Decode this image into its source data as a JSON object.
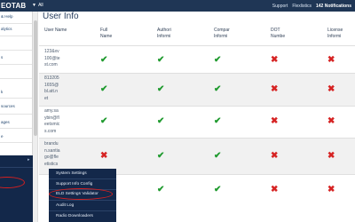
{
  "topbar": {
    "logo": "EOTAB",
    "database_selector": "All",
    "links": [
      "Support",
      "Flexlistics"
    ],
    "notifications": "142 Notifications"
  },
  "sidebar": {
    "items": [
      "& Help",
      "alytics"
    ],
    "partial_labels": [
      "s",
      "k",
      "sources",
      "ages",
      "e"
    ]
  },
  "main": {
    "title": "User Info",
    "columns": [
      "User Name",
      "Full Name",
      "Authori Informi",
      "Compar Informi",
      "DOT Numbe",
      "License Informi"
    ],
    "rows": [
      {
        "user": [
          "123&xv",
          "100@te",
          "st.com"
        ],
        "full_name": true,
        "authority": true,
        "company": true,
        "dot": false,
        "license": false
      },
      {
        "user": [
          "813205",
          "1655@",
          "bl.att.n",
          "et"
        ],
        "full_name": true,
        "authority": true,
        "company": true,
        "dot": false,
        "license": false
      },
      {
        "user": [
          "amy.sa",
          "ybin@fl",
          "eetsmic",
          "s.com"
        ],
        "full_name": true,
        "authority": true,
        "company": true,
        "dot": false,
        "license": false
      },
      {
        "user": [
          "brandu",
          "n.santia",
          "go@fle",
          "etistics"
        ],
        "full_name": false,
        "authority": true,
        "company": true,
        "dot": false,
        "license": false
      },
      {
        "user": [
          ""
        ],
        "full_name": true,
        "authority": true,
        "company": true,
        "dot": false,
        "license": false
      }
    ]
  },
  "flyout": {
    "items": [
      "System Settings",
      "Support Info Config",
      "ELD Settings Validator",
      "Audit Log",
      "Radio Downloaders"
    ],
    "highlighted": "ELD Settings Validator"
  },
  "colors": {
    "topbar": "#1f3655",
    "flyout": "#13284a",
    "check": "#1f9a2e",
    "cross": "#d62323",
    "highlight_oval": "#d42020"
  },
  "icons": {
    "check": "check-icon",
    "cross": "cross-icon"
  }
}
